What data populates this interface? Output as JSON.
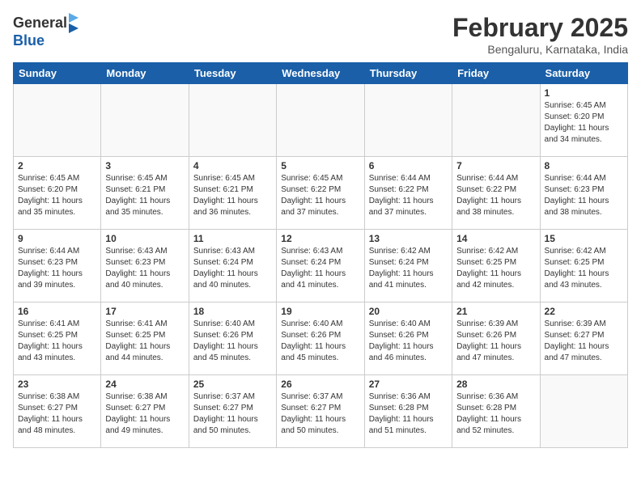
{
  "header": {
    "logo_line1": "General",
    "logo_line2": "Blue",
    "month": "February 2025",
    "location": "Bengaluru, Karnataka, India"
  },
  "days_of_week": [
    "Sunday",
    "Monday",
    "Tuesday",
    "Wednesday",
    "Thursday",
    "Friday",
    "Saturday"
  ],
  "weeks": [
    [
      {
        "num": "",
        "info": ""
      },
      {
        "num": "",
        "info": ""
      },
      {
        "num": "",
        "info": ""
      },
      {
        "num": "",
        "info": ""
      },
      {
        "num": "",
        "info": ""
      },
      {
        "num": "",
        "info": ""
      },
      {
        "num": "1",
        "info": "Sunrise: 6:45 AM\nSunset: 6:20 PM\nDaylight: 11 hours\nand 34 minutes."
      }
    ],
    [
      {
        "num": "2",
        "info": "Sunrise: 6:45 AM\nSunset: 6:20 PM\nDaylight: 11 hours\nand 35 minutes."
      },
      {
        "num": "3",
        "info": "Sunrise: 6:45 AM\nSunset: 6:21 PM\nDaylight: 11 hours\nand 35 minutes."
      },
      {
        "num": "4",
        "info": "Sunrise: 6:45 AM\nSunset: 6:21 PM\nDaylight: 11 hours\nand 36 minutes."
      },
      {
        "num": "5",
        "info": "Sunrise: 6:45 AM\nSunset: 6:22 PM\nDaylight: 11 hours\nand 37 minutes."
      },
      {
        "num": "6",
        "info": "Sunrise: 6:44 AM\nSunset: 6:22 PM\nDaylight: 11 hours\nand 37 minutes."
      },
      {
        "num": "7",
        "info": "Sunrise: 6:44 AM\nSunset: 6:22 PM\nDaylight: 11 hours\nand 38 minutes."
      },
      {
        "num": "8",
        "info": "Sunrise: 6:44 AM\nSunset: 6:23 PM\nDaylight: 11 hours\nand 38 minutes."
      }
    ],
    [
      {
        "num": "9",
        "info": "Sunrise: 6:44 AM\nSunset: 6:23 PM\nDaylight: 11 hours\nand 39 minutes."
      },
      {
        "num": "10",
        "info": "Sunrise: 6:43 AM\nSunset: 6:23 PM\nDaylight: 11 hours\nand 40 minutes."
      },
      {
        "num": "11",
        "info": "Sunrise: 6:43 AM\nSunset: 6:24 PM\nDaylight: 11 hours\nand 40 minutes."
      },
      {
        "num": "12",
        "info": "Sunrise: 6:43 AM\nSunset: 6:24 PM\nDaylight: 11 hours\nand 41 minutes."
      },
      {
        "num": "13",
        "info": "Sunrise: 6:42 AM\nSunset: 6:24 PM\nDaylight: 11 hours\nand 41 minutes."
      },
      {
        "num": "14",
        "info": "Sunrise: 6:42 AM\nSunset: 6:25 PM\nDaylight: 11 hours\nand 42 minutes."
      },
      {
        "num": "15",
        "info": "Sunrise: 6:42 AM\nSunset: 6:25 PM\nDaylight: 11 hours\nand 43 minutes."
      }
    ],
    [
      {
        "num": "16",
        "info": "Sunrise: 6:41 AM\nSunset: 6:25 PM\nDaylight: 11 hours\nand 43 minutes."
      },
      {
        "num": "17",
        "info": "Sunrise: 6:41 AM\nSunset: 6:25 PM\nDaylight: 11 hours\nand 44 minutes."
      },
      {
        "num": "18",
        "info": "Sunrise: 6:40 AM\nSunset: 6:26 PM\nDaylight: 11 hours\nand 45 minutes."
      },
      {
        "num": "19",
        "info": "Sunrise: 6:40 AM\nSunset: 6:26 PM\nDaylight: 11 hours\nand 45 minutes."
      },
      {
        "num": "20",
        "info": "Sunrise: 6:40 AM\nSunset: 6:26 PM\nDaylight: 11 hours\nand 46 minutes."
      },
      {
        "num": "21",
        "info": "Sunrise: 6:39 AM\nSunset: 6:26 PM\nDaylight: 11 hours\nand 47 minutes."
      },
      {
        "num": "22",
        "info": "Sunrise: 6:39 AM\nSunset: 6:27 PM\nDaylight: 11 hours\nand 47 minutes."
      }
    ],
    [
      {
        "num": "23",
        "info": "Sunrise: 6:38 AM\nSunset: 6:27 PM\nDaylight: 11 hours\nand 48 minutes."
      },
      {
        "num": "24",
        "info": "Sunrise: 6:38 AM\nSunset: 6:27 PM\nDaylight: 11 hours\nand 49 minutes."
      },
      {
        "num": "25",
        "info": "Sunrise: 6:37 AM\nSunset: 6:27 PM\nDaylight: 11 hours\nand 50 minutes."
      },
      {
        "num": "26",
        "info": "Sunrise: 6:37 AM\nSunset: 6:27 PM\nDaylight: 11 hours\nand 50 minutes."
      },
      {
        "num": "27",
        "info": "Sunrise: 6:36 AM\nSunset: 6:28 PM\nDaylight: 11 hours\nand 51 minutes."
      },
      {
        "num": "28",
        "info": "Sunrise: 6:36 AM\nSunset: 6:28 PM\nDaylight: 11 hours\nand 52 minutes."
      },
      {
        "num": "",
        "info": ""
      }
    ]
  ]
}
